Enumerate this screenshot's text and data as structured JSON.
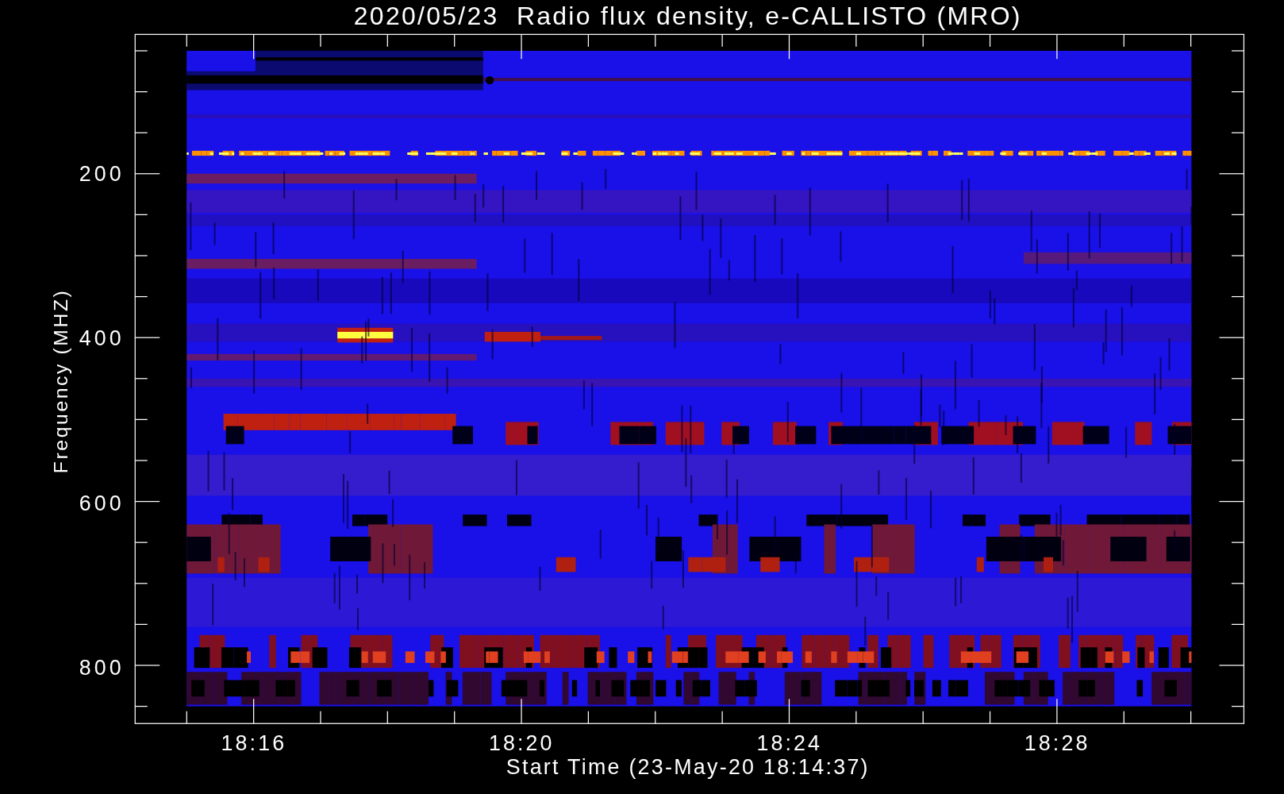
{
  "title": "2020/05/23  Radio flux density, e-CALLISTO (MRO)",
  "y_axis": {
    "label": "Frequency (MHZ)",
    "tick_labels": [
      "200",
      "400",
      "600",
      "800"
    ]
  },
  "x_axis": {
    "label": "Start Time (23-May-20 18:14:37)",
    "tick_labels": [
      "18:16",
      "18:20",
      "18:24",
      "18:28"
    ]
  }
}
